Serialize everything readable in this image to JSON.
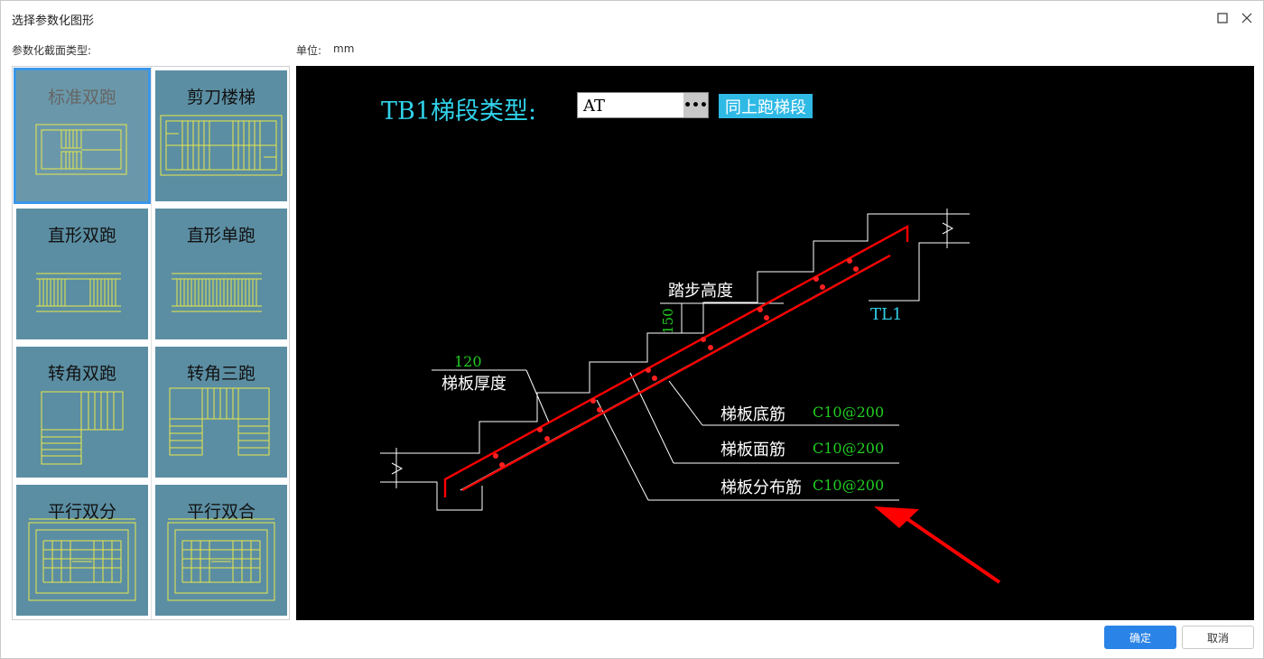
{
  "window": {
    "title": "选择参数化图形",
    "maximize_icon": "maximize-icon",
    "close_icon": "close-icon"
  },
  "labels": {
    "section_type": "参数化截面类型:",
    "unit_label": "单位:",
    "unit_value": "mm"
  },
  "gallery": {
    "items": [
      {
        "label": "标准双跑",
        "selected": true
      },
      {
        "label": "剪刀楼梯",
        "selected": false
      },
      {
        "label": "直形双跑",
        "selected": false
      },
      {
        "label": "直形单跑",
        "selected": false
      },
      {
        "label": "转角双跑",
        "selected": false
      },
      {
        "label": "转角三跑",
        "selected": false
      },
      {
        "label": "平行双分",
        "selected": false
      },
      {
        "label": "平行双合",
        "selected": false
      }
    ]
  },
  "canvas": {
    "heading": "TB1梯段类型:",
    "type_value": "AT",
    "type_button": "•••",
    "same_button": "同上跑梯段",
    "thickness_value": "120",
    "thickness_label": "梯板厚度",
    "step_height_label": "踏步高度",
    "step_height_value": "150",
    "beam_label": "TL1",
    "rebars": [
      {
        "label": "梯板底筋",
        "value": "C10@200"
      },
      {
        "label": "梯板面筋",
        "value": "C10@200"
      },
      {
        "label": "梯板分布筋",
        "value": "C10@200"
      }
    ],
    "colors": {
      "background": "#000000",
      "heading": "#30d0e8",
      "value_green": "#22cc22",
      "rebar_red": "#ff0000",
      "outline": "#ffffff"
    }
  },
  "footer": {
    "ok": "确定",
    "cancel": "取消"
  }
}
